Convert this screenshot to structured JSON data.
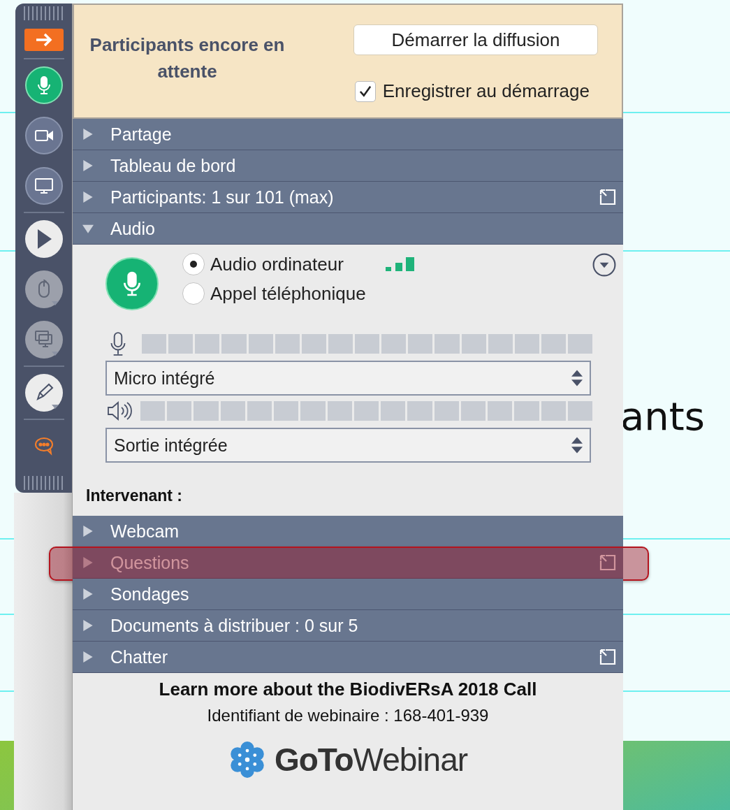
{
  "slide": {
    "fragments": [
      {
        "text": "ants",
        "kind": "right"
      }
    ]
  },
  "toolbar_groups": [
    {
      "buttons": [
        {
          "kind": "collapse",
          "disabled": false,
          "has_menu": false
        }
      ]
    },
    {
      "buttons": [
        {
          "kind": "mic",
          "disabled": false,
          "has_menu": false
        },
        {
          "kind": "webcam",
          "disabled": false,
          "has_menu": false
        },
        {
          "kind": "screen",
          "disabled": false,
          "has_menu": false
        }
      ]
    },
    {
      "buttons": [
        {
          "kind": "play",
          "disabled": false,
          "has_menu": false
        },
        {
          "kind": "mouse",
          "disabled": true,
          "has_menu": true
        },
        {
          "kind": "screens",
          "disabled": true,
          "has_menu": true
        }
      ]
    },
    {
      "buttons": [
        {
          "kind": "pen",
          "disabled": false,
          "has_menu": true
        }
      ]
    },
    {
      "buttons": [
        {
          "kind": "chat",
          "disabled": false,
          "has_menu": false
        }
      ]
    }
  ],
  "header": {
    "title": "Participants encore en attente",
    "button": "Démarrer la diffusion",
    "record": {
      "label": "Enregistrer au démarrage",
      "checked": true
    }
  },
  "sections_top": [
    {
      "label": "Partage",
      "expanded": false,
      "popout": false,
      "highlighted": false
    },
    {
      "label": "Tableau de bord",
      "expanded": false,
      "popout": false,
      "highlighted": false
    },
    {
      "label": "Participants: 1 sur 101 (max)",
      "expanded": false,
      "popout": true,
      "highlighted": false
    },
    {
      "label": "Audio",
      "expanded": true,
      "popout": false,
      "highlighted": false
    }
  ],
  "audio": {
    "mic_on": true,
    "modes": [
      {
        "label": "Audio ordinateur",
        "selected": true
      },
      {
        "label": "Appel téléphonique",
        "selected": false
      }
    ],
    "microphone": {
      "level": 0,
      "device": "Micro intégré"
    },
    "speaker": {
      "level": 0,
      "device": "Sortie intégrée"
    },
    "speaker_label": "Intervenant :"
  },
  "sections_bottom": [
    {
      "label": "Webcam",
      "expanded": false,
      "popout": false,
      "highlighted": false
    },
    {
      "label": "Questions",
      "expanded": false,
      "popout": true,
      "highlighted": true
    },
    {
      "label": "Sondages",
      "expanded": false,
      "popout": false,
      "highlighted": false
    },
    {
      "label": "Documents à distribuer : 0 sur 5",
      "expanded": false,
      "popout": false,
      "highlighted": false
    },
    {
      "label": "Chatter",
      "expanded": false,
      "popout": true,
      "highlighted": false
    }
  ],
  "footer": {
    "title": "Learn more about the BiodivERsA 2018 Call",
    "webinar_id": "Identifiant de webinaire : 168-401-939",
    "logo": "**GoTo**Webinar"
  }
}
